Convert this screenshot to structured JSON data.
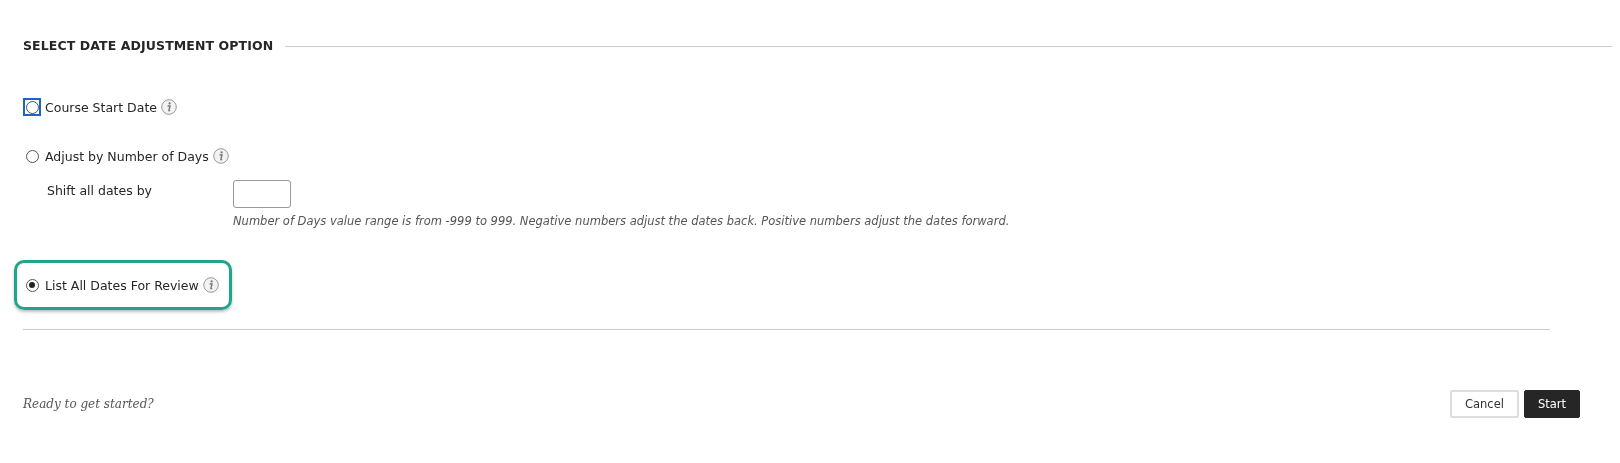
{
  "section": {
    "title": "SELECT DATE ADJUSTMENT OPTION"
  },
  "options": [
    {
      "label": "Course Start Date",
      "selected": false,
      "focused": true,
      "highlighted": false
    },
    {
      "label": "Adjust by Number of Days",
      "selected": false,
      "focused": false,
      "highlighted": false,
      "field": {
        "label": "Shift all dates by",
        "hint": "Number of Days value range is from -999 to 999. Negative numbers adjust the dates back. Positive numbers adjust the dates forward."
      }
    },
    {
      "label": "List All Dates For Review",
      "selected": true,
      "focused": false,
      "highlighted": true
    }
  ],
  "footer": {
    "prompt": "Ready to get started?",
    "buttons": [
      {
        "label": "Cancel",
        "kind": "secondary"
      },
      {
        "label": "Start",
        "kind": "primary"
      }
    ]
  }
}
